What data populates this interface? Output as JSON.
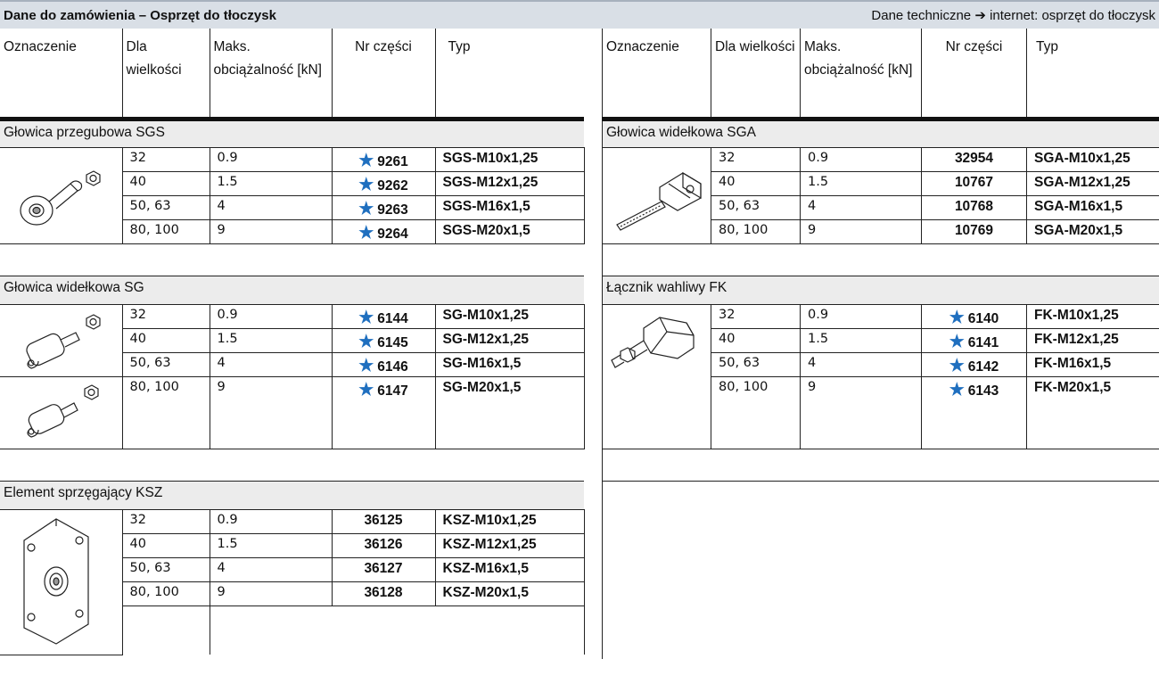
{
  "header": {
    "title": "Dane do zamówienia – Osprzęt do tłoczysk",
    "right_prefix": "Dane techniczne",
    "right_arrow": "➔",
    "right_suffix": "internet: osprzęt do tłoczysk"
  },
  "columns": {
    "oznaczenie": "Oznaczenie",
    "dla": "Dla wielkości",
    "maks": "Maks. obciążalność [kN]",
    "nr": "Nr części",
    "typ": "Typ"
  },
  "star_symbol": "★",
  "star_color": "#1f6fbf",
  "sections": {
    "sgs": {
      "title": "Głowica przegubowa SGS",
      "rows": [
        {
          "size": "32",
          "load": "0.9",
          "part": "9261",
          "type": "SGS-M10x1,25",
          "star": true
        },
        {
          "size": "40",
          "load": "1.5",
          "part": "9262",
          "type": "SGS-M12x1,25",
          "star": true
        },
        {
          "size": "50, 63",
          "load": "4",
          "part": "9263",
          "type": "SGS-M16x1,5",
          "star": true
        },
        {
          "size": "80, 100",
          "load": "9",
          "part": "9264",
          "type": "SGS-M20x1,5",
          "star": true
        }
      ]
    },
    "sg": {
      "title": "Głowica widełkowa SG",
      "rows": [
        {
          "size": "32",
          "load": "0.9",
          "part": "6144",
          "type": "SG-M10x1,25",
          "star": true
        },
        {
          "size": "40",
          "load": "1.5",
          "part": "6145",
          "type": "SG-M12x1,25",
          "star": true
        },
        {
          "size": "50, 63",
          "load": "4",
          "part": "6146",
          "type": "SG-M16x1,5",
          "star": true
        },
        {
          "size": "80, 100",
          "load": "9",
          "part": "6147",
          "type": "SG-M20x1,5",
          "star": true
        }
      ]
    },
    "ksz": {
      "title": "Element sprzęgający KSZ",
      "rows": [
        {
          "size": "32",
          "load": "0.9",
          "part": "36125",
          "type": "KSZ-M10x1,25",
          "star": false
        },
        {
          "size": "40",
          "load": "1.5",
          "part": "36126",
          "type": "KSZ-M12x1,25",
          "star": false
        },
        {
          "size": "50, 63",
          "load": "4",
          "part": "36127",
          "type": "KSZ-M16x1,5",
          "star": false
        },
        {
          "size": "80, 100",
          "load": "9",
          "part": "36128",
          "type": "KSZ-M20x1,5",
          "star": false
        }
      ]
    },
    "sga": {
      "title": "Głowica widełkowa SGA",
      "rows": [
        {
          "size": "32",
          "load": "0.9",
          "part": "32954",
          "type": "SGA-M10x1,25",
          "star": false
        },
        {
          "size": "40",
          "load": "1.5",
          "part": "10767",
          "type": "SGA-M12x1,25",
          "star": false
        },
        {
          "size": "50, 63",
          "load": "4",
          "part": "10768",
          "type": "SGA-M16x1,5",
          "star": false
        },
        {
          "size": "80, 100",
          "load": "9",
          "part": "10769",
          "type": "SGA-M20x1,5",
          "star": false
        }
      ]
    },
    "fk": {
      "title": "Łącznik wahliwy FK",
      "rows": [
        {
          "size": "32",
          "load": "0.9",
          "part": "6140",
          "type": "FK-M10x1,25",
          "star": true
        },
        {
          "size": "40",
          "load": "1.5",
          "part": "6141",
          "type": "FK-M12x1,25",
          "star": true
        },
        {
          "size": "50, 63",
          "load": "4",
          "part": "6142",
          "type": "FK-M16x1,5",
          "star": true
        },
        {
          "size": "80, 100",
          "load": "9",
          "part": "6143",
          "type": "FK-M20x1,5",
          "star": true
        }
      ]
    }
  }
}
